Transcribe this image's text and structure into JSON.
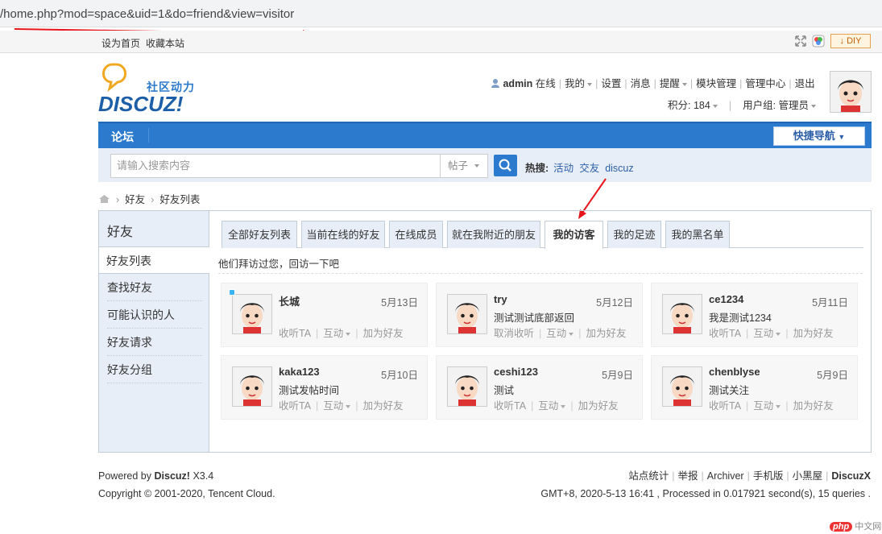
{
  "url": "/home.php?mod=space&uid=1&do=friend&view=visitor",
  "topbar": {
    "set_home": "设为首页",
    "bookmark": "收藏本站",
    "diy": "DIY"
  },
  "logo": {
    "tagline": "社区动力",
    "brand": "DISCUZ!"
  },
  "user_nav": {
    "username": "admin",
    "status": "在线",
    "items": [
      "我的",
      "设置",
      "消息",
      "提醒",
      "模块管理",
      "管理中心",
      "退出"
    ],
    "credits": "积分: 184",
    "group": "用户组: 管理员"
  },
  "nav": {
    "home": "论坛",
    "quick_nav": "快捷导航"
  },
  "search": {
    "placeholder": "请输入搜索内容",
    "type": "帖子",
    "hot_label": "热搜:",
    "hot_items": [
      "活动",
      "交友",
      "discuz"
    ]
  },
  "breadcrumb": [
    "好友",
    "好友列表"
  ],
  "sidebar": {
    "title": "好友",
    "items": [
      "好友列表",
      "查找好友",
      "可能认识的人",
      "好友请求",
      "好友分组"
    ]
  },
  "tabs": [
    "全部好友列表",
    "当前在线的好友",
    "在线成员",
    "就在我附近的朋友",
    "我的访客",
    "我的足迹",
    "我的黑名单"
  ],
  "visitor_note": "他们拜访过您，回访一下吧",
  "visitors": [
    {
      "name": "长城",
      "date": "5月13日",
      "message": "",
      "follow": "收听TA",
      "interact": "互动",
      "add": "加为好友",
      "online": true
    },
    {
      "name": "try",
      "date": "5月12日",
      "message": "测试测试底部返回",
      "follow": "取消收听",
      "interact": "互动",
      "add": "加为好友",
      "online": false
    },
    {
      "name": "ce1234",
      "date": "5月11日",
      "message": "我是测试1234",
      "follow": "收听TA",
      "interact": "互动",
      "add": "加为好友",
      "online": false
    },
    {
      "name": "kaka123",
      "date": "5月10日",
      "message": "测试发帖时间",
      "follow": "收听TA",
      "interact": "互动",
      "add": "加为好友",
      "online": false
    },
    {
      "name": "ceshi123",
      "date": "5月9日",
      "message": "测试",
      "follow": "收听TA",
      "interact": "互动",
      "add": "加为好友",
      "online": false
    },
    {
      "name": "chenblyse",
      "date": "5月9日",
      "message": "测试关注",
      "follow": "收听TA",
      "interact": "互动",
      "add": "加为好友",
      "online": false
    }
  ],
  "footer": {
    "powered_prefix": "Powered by",
    "powered_brand": "Discuz!",
    "version": "X3.4",
    "copyright": "Copyright © 2001-2020, Tencent Cloud.",
    "links": [
      "站点统计",
      "举报",
      "Archiver",
      "手机版",
      "小黑屋"
    ],
    "brand_link": "DiscuzX",
    "stats": "GMT+8, 2020-5-13 16:41 , Processed in 0.017921 second(s), 15 queries ."
  },
  "watermark": {
    "badge": "php",
    "text": "中文网"
  },
  "colors": {
    "nav_blue": "#2b7acd",
    "link_blue": "#2b5fa7",
    "panel_bg": "#e8eef7",
    "annotation_red": "#e8141c"
  }
}
